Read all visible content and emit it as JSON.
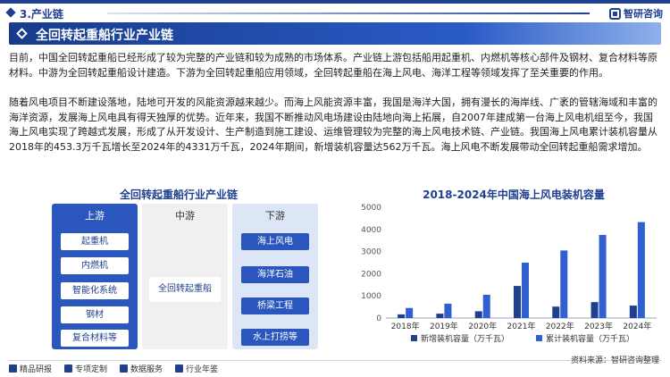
{
  "header": {
    "section": "3.产业链",
    "brand": "智研咨询"
  },
  "banner": {
    "title": "全回转起重船行业产业链"
  },
  "paragraphs": {
    "p1": "目前，中国全回转起重船已经形成了较为完整的产业链和较为成熟的市场体系。产业链上游包括船用起重机、内燃机等核心部件及钢材、复合材料等原材料。中游为全回转起重船设计建造。下游为全回转起重船应用领域，全回转起重船在海上风电、海洋工程等领域发挥了至关重要的作用。",
    "p2": "随着风电项目不断建设落地，陆地可开发的风能资源越来越少。而海上风能资源丰富，我国是海洋大国，拥有漫长的海岸线、广袤的管辖海域和丰富的海洋资源，发展海上风电具有得天独厚的优势。近年来，我国不断推动风电场建设由陆地向海上拓展，自2007年建成第一台海上风电机组至今，我国海上风电实现了跨越式发展，形成了从开发设计、生产制造到施工建设、运维管理较为完整的海上风电技术链、产业链。我国海上风电累计装机容量从2018年的453.3万千瓦增长至2024年的4331万千瓦，2024年期间，新增装机容量达562万千瓦。海上风电不断发展带动全回转起重船需求增加。"
  },
  "chain": {
    "title": "全回转起重船行业产业链",
    "upstream": {
      "label": "上游",
      "items": [
        "起重机",
        "内燃机",
        "智能化系统",
        "钢材",
        "复合材料等"
      ]
    },
    "midstream": {
      "label": "中游",
      "items": [
        "全回转起重船"
      ]
    },
    "downstream": {
      "label": "下游",
      "items": [
        "海上风电",
        "海洋石油",
        "桥梁工程",
        "水上打捞等"
      ]
    }
  },
  "chart_data": {
    "type": "bar",
    "title": "2018-2024年中国海上风电装机容量",
    "categories": [
      "2018年",
      "2019年",
      "2020年",
      "2021年",
      "2022年",
      "2023年",
      "2024年"
    ],
    "series": [
      {
        "name": "新增装机容量（万千瓦）",
        "color": "#1f3f8f",
        "values": [
          165,
          198,
          306,
          1448,
          516,
          718,
          562
        ]
      },
      {
        "name": "累计装机容量（万千瓦）",
        "color": "#2f5fd0",
        "values": [
          453.3,
          650,
          1050,
          2500,
          3050,
          3750,
          4331
        ]
      }
    ],
    "ylim": [
      0,
      5000
    ],
    "yticks": [
      "0",
      "1000",
      "2000",
      "3000",
      "4000",
      "5000"
    ],
    "legend": "bottom",
    "grid": false
  },
  "source": "资料来源：智研咨询整理",
  "footer": {
    "left_items": [
      "精品研报",
      "专项定制",
      "数据服务",
      "行业年鉴"
    ]
  }
}
